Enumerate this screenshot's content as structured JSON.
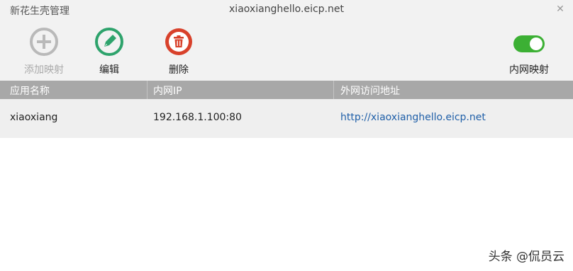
{
  "window": {
    "app_title": "新花生壳管理",
    "domain_title": "xiaoxianghello.eicp.net",
    "close_glyph": "✕"
  },
  "toolbar": {
    "add": {
      "label": "添加映射",
      "icon": "plus-circle-icon",
      "color": "#b9b9b9",
      "enabled": false
    },
    "edit": {
      "label": "编辑",
      "icon": "pencil-circle-icon",
      "color": "#2ea36c"
    },
    "delete": {
      "label": "删除",
      "icon": "trash-circle-icon",
      "color": "#d8412b"
    },
    "intranet_mapping": {
      "label": "内网映射",
      "on": true,
      "color": "#3cb034"
    }
  },
  "table": {
    "columns": [
      "应用名称",
      "内网IP",
      "外网访问地址"
    ],
    "rows": [
      {
        "app_name": "xiaoxiang",
        "intranet_ip": "192.168.1.100:80",
        "external_url": "http://xiaoxianghello.eicp.net"
      }
    ]
  },
  "watermark": "头条 @侃员云"
}
